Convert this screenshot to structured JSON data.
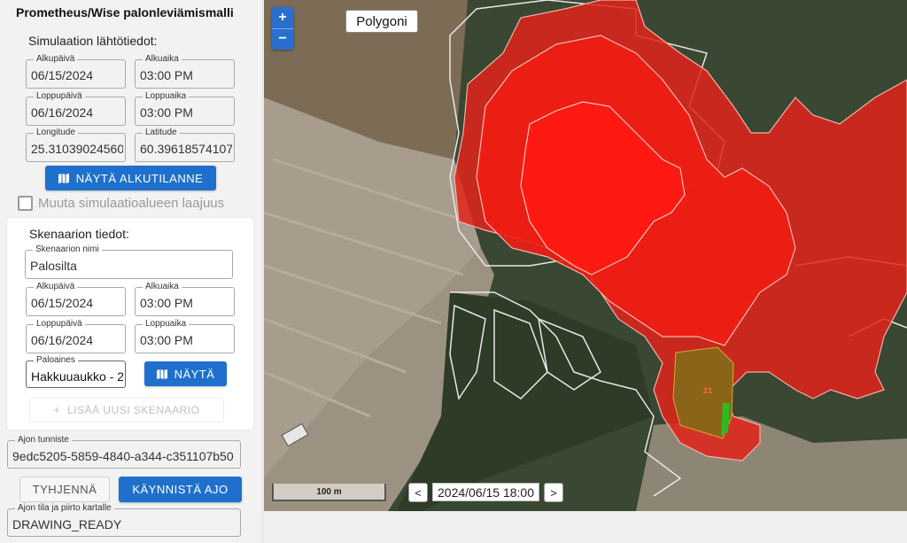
{
  "app": {
    "title": "Prometheus/Wise palonleviämismalli"
  },
  "simulation": {
    "heading": "Simulaation lähtötiedot:",
    "start_date": {
      "label": "Alkupäivä",
      "value": "06/15/2024"
    },
    "start_time": {
      "label": "Alkuaika",
      "value": "03:00 PM"
    },
    "end_date": {
      "label": "Loppupäivä",
      "value": "06/16/2024"
    },
    "end_time": {
      "label": "Loppuaika",
      "value": "03:00 PM"
    },
    "longitude": {
      "label": "Longitude",
      "value": "25.31039024560"
    },
    "latitude": {
      "label": "Latitude",
      "value": "60.39618574107"
    },
    "show_initial_button": "NÄYTÄ ALKUTILANNE",
    "change_area_label": "Muuta simulaatioalueen laajuus",
    "change_area_checked": false
  },
  "scenario": {
    "heading": "Skenaarion tiedot:",
    "name": {
      "label": "Skenaarion nimi",
      "value": "Palosilta"
    },
    "start_date": {
      "label": "Alkupäivä",
      "value": "06/15/2024"
    },
    "start_time": {
      "label": "Alkuaika",
      "value": "03:00 PM"
    },
    "end_date": {
      "label": "Loppupäivä",
      "value": "06/16/2024"
    },
    "end_time": {
      "label": "Loppuaika",
      "value": "03:00 PM"
    },
    "fuel": {
      "label": "Paloaines",
      "value": "Hakkuuaukko - 2"
    },
    "show_button": "NÄYTÄ",
    "add_button": "LISÄÄ UUSI SKENAARIO"
  },
  "run": {
    "id": {
      "label": "Ajon tunniste",
      "value": "9edc5205-5859-4840-a344-c351107b50"
    },
    "clear_button": "TYHJENNÄ",
    "start_button": "KÄYNNISTÄ AJO",
    "status": {
      "label": "Ajon tila ja piirto kartalle",
      "value": "DRAWING_READY"
    }
  },
  "map": {
    "zoom_in": "+",
    "zoom_out": "−",
    "polygon_button": "Polygoni",
    "scale_label": "100 m",
    "time_prev": "<",
    "time_value": "2024/06/15 18:00",
    "time_next": ">",
    "ignition_label": "21",
    "colors": {
      "fire_outer": "#e2231a",
      "fire_inner": "#ff1a12",
      "ignition_area": "#8a6418",
      "ignition_edge": "#2dbb22"
    }
  }
}
